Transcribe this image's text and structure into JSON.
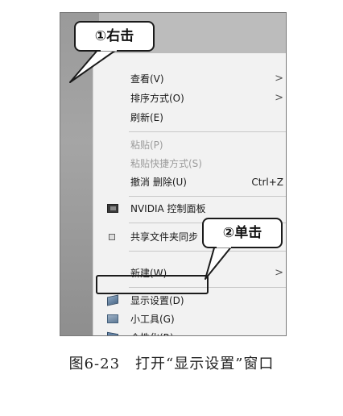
{
  "callouts": {
    "right_click": "①右击",
    "single_click": "②单击"
  },
  "menu": {
    "items": [
      {
        "label": "查看(V)",
        "has_submenu": true
      },
      {
        "label": "排序方式(O)",
        "has_submenu": true
      },
      {
        "label": "刷新(E)"
      },
      {
        "label": "粘贴(P)",
        "disabled": true
      },
      {
        "label": "粘贴快捷方式(S)",
        "disabled": true
      },
      {
        "label": "撤消 删除(U)",
        "shortcut": "Ctrl+Z"
      },
      {
        "label": "NVIDIA 控制面板",
        "icon": "nvidia-icon"
      },
      {
        "label": "共享文件夹同步",
        "icon": "share-sync-icon",
        "has_submenu": true
      },
      {
        "label": "新建(W)",
        "has_submenu": true
      },
      {
        "label": "显示设置(D)",
        "icon": "display-icon",
        "highlighted": true
      },
      {
        "label": "小工具(G)",
        "icon": "gadgets-icon"
      },
      {
        "label": "个性化(R)",
        "icon": "personalize-icon"
      }
    ],
    "arrow_glyph": ">"
  },
  "caption": "图6-23　打开“显示设置”窗口",
  "colors": {
    "menu_bg": "#f2f2f2",
    "disabled_text": "#9c9c9c",
    "desktop": "#bcbcbc",
    "outline": "#1a1a1a"
  }
}
